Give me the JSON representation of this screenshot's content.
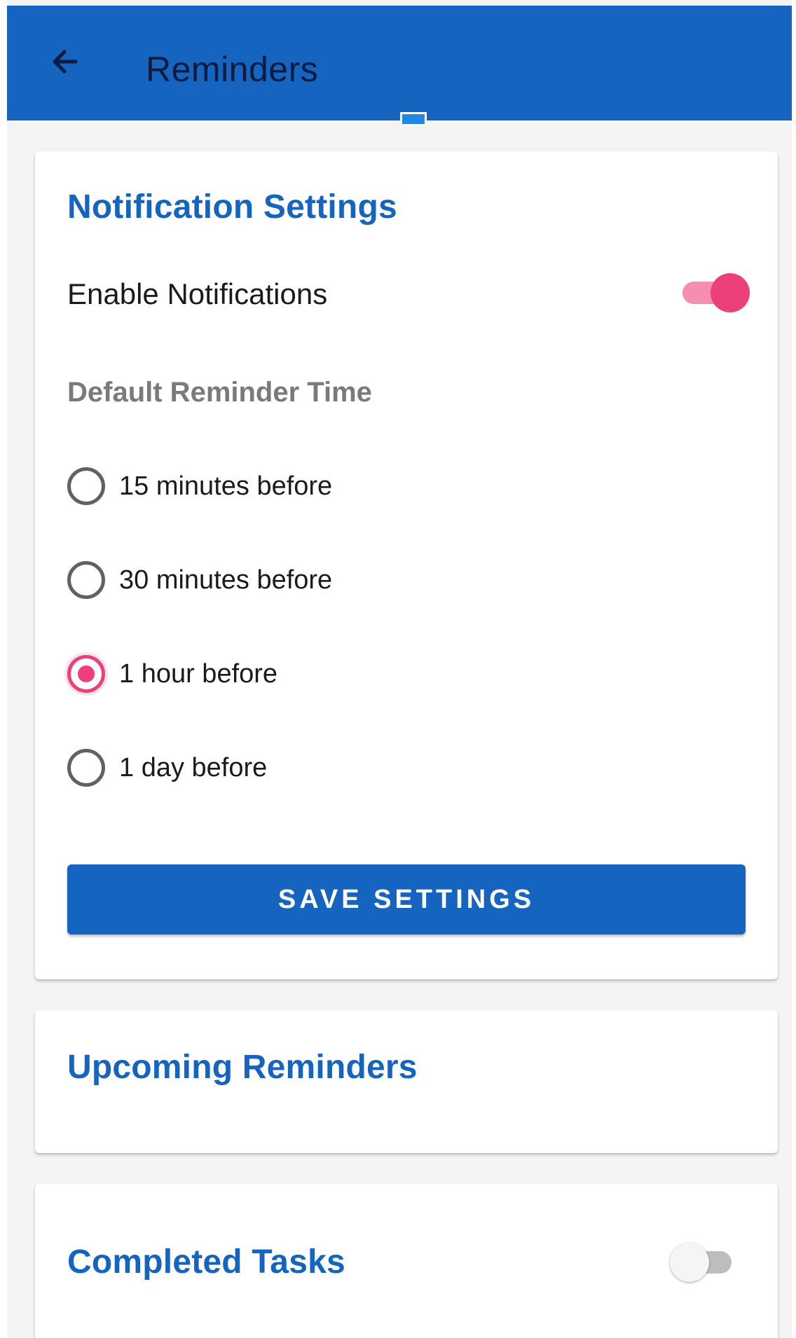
{
  "app_bar": {
    "title": "Reminders",
    "back_icon": "arrow-left-icon",
    "background": "#1565c0"
  },
  "notification_settings": {
    "title": "Notification Settings",
    "enable_label": "Enable Notifications",
    "enabled": true,
    "default_time_label": "Default Reminder Time",
    "options": [
      {
        "label": "15 minutes before",
        "selected": false
      },
      {
        "label": "30 minutes before",
        "selected": false
      },
      {
        "label": "1 hour before",
        "selected": true
      },
      {
        "label": "1 day before",
        "selected": false
      }
    ],
    "save_label": "SAVE SETTINGS"
  },
  "upcoming": {
    "title": "Upcoming Reminders"
  },
  "completed": {
    "title": "Completed Tasks",
    "show_enabled": false
  },
  "colors": {
    "primary": "#1565c0",
    "accent": "#ec407a"
  }
}
